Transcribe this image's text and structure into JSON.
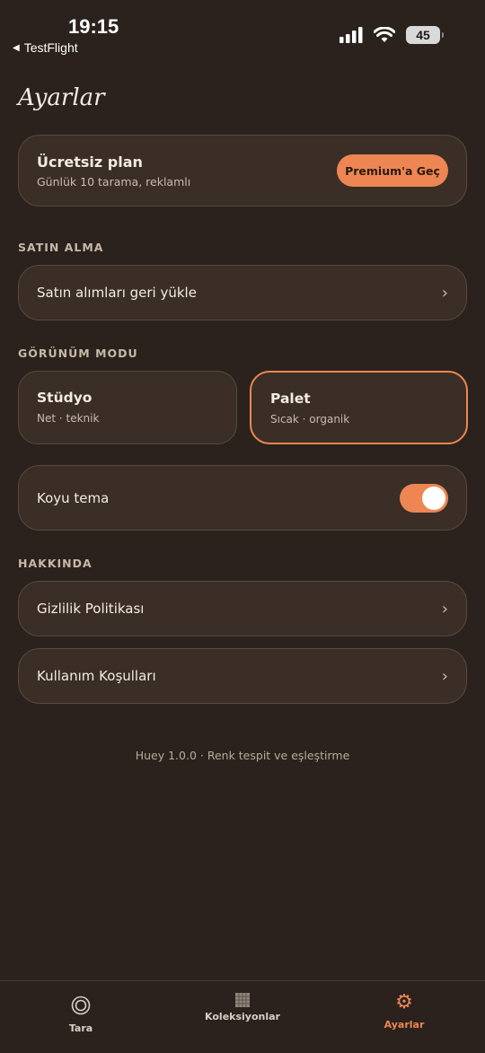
{
  "status_bar": {
    "time": "19:15",
    "back_label": "TestFlight",
    "battery": "45"
  },
  "header": {
    "title": "Ayarlar"
  },
  "plan": {
    "title": "Ücretsiz plan",
    "subtitle": "Günlük 10 tarama, reklamlı",
    "button_label": "Premium'a Geç"
  },
  "sections": {
    "purchase": {
      "label": "SATIN ALMA",
      "restore_label": "Satın alımları geri yükle"
    },
    "appearance": {
      "label": "GÖRÜNÜM MODU",
      "modes": [
        {
          "title": "Stüdyo",
          "subtitle": "Net · teknik",
          "selected": false
        },
        {
          "title": "Palet",
          "subtitle": "Sıcak · organik",
          "selected": true
        }
      ],
      "dark_theme_label": "Koyu tema",
      "dark_theme_on": true
    },
    "about": {
      "label": "HAKKINDA",
      "privacy_label": "Gizlilik Politikası",
      "terms_label": "Kullanım Koşulları"
    }
  },
  "footer": {
    "text": "Huey 1.0.0 · Renk tespit ve eşleştirme"
  },
  "tabbar": {
    "tabs": [
      {
        "label": "Tara",
        "icon": "scan-circle-icon",
        "active": false
      },
      {
        "label": "Koleksiyonlar",
        "icon": "grid-icon",
        "active": false
      },
      {
        "label": "Ayarlar",
        "icon": "gear-icon",
        "active": true
      }
    ]
  },
  "colors": {
    "background": "#2b221d",
    "card": "#3a2e26",
    "accent": "#ee8653",
    "text": "#f4ece4"
  }
}
